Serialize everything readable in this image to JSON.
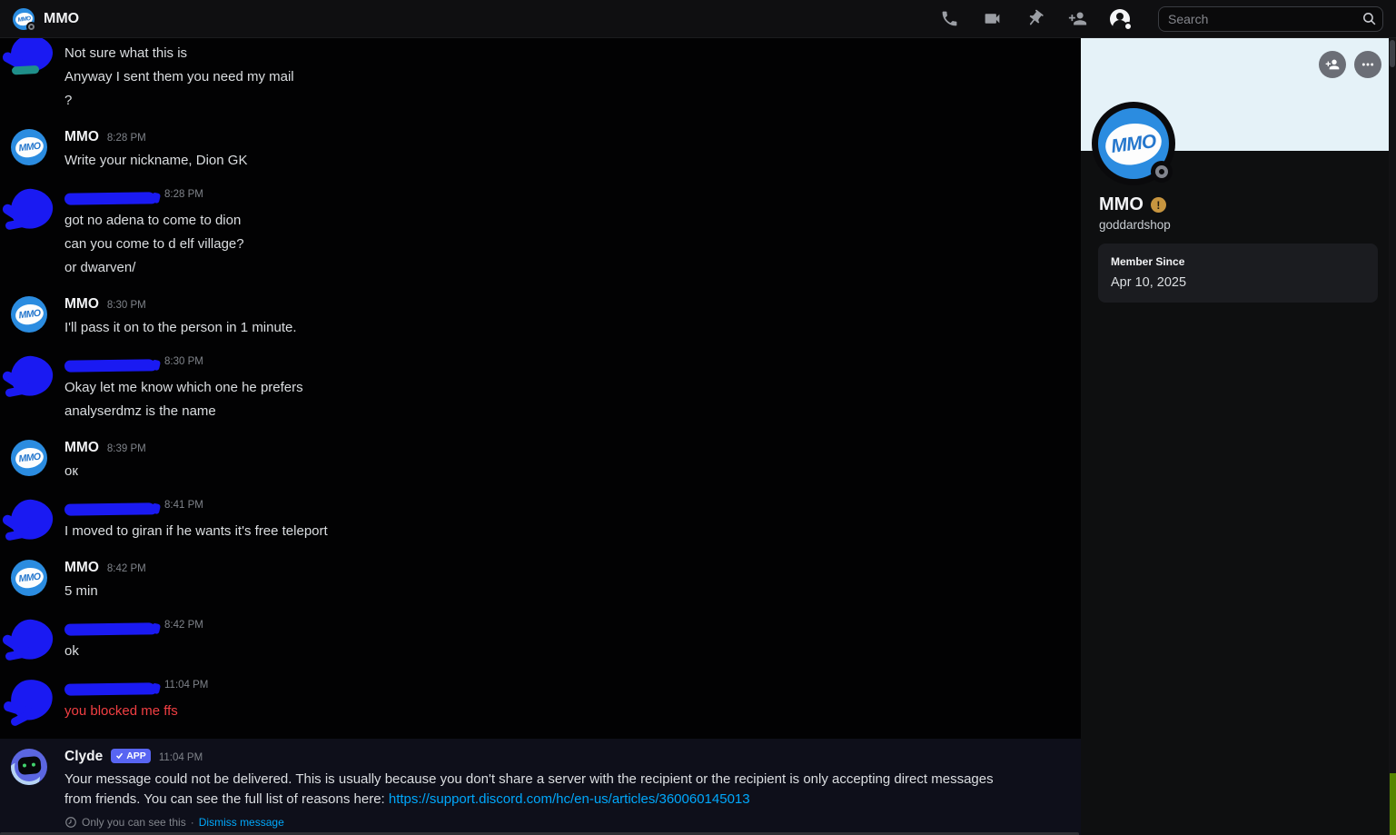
{
  "topbar": {
    "title": "MMO",
    "search_placeholder": "Search",
    "icons": [
      {
        "name": "start-voice-call-icon"
      },
      {
        "name": "start-video-call-icon"
      },
      {
        "name": "pinned-messages-icon"
      },
      {
        "name": "add-friends-to-dm-icon"
      },
      {
        "name": "user-profile-icon"
      },
      {
        "name": "search-icon"
      }
    ]
  },
  "chat": {
    "groups": [
      {
        "kind": "user",
        "header": false,
        "partial": true,
        "time": "",
        "lines": [
          {
            "t": "Not sure what this is"
          },
          {
            "t": "Anyway I sent them you need my mail"
          },
          {
            "t": "?"
          }
        ]
      },
      {
        "kind": "mmo",
        "header": true,
        "name": "MMO",
        "time": "8:28 PM",
        "lines": [
          {
            "t": "Write your nickname, Dion GK"
          }
        ]
      },
      {
        "kind": "user",
        "header": true,
        "time": "8:28 PM",
        "lines": [
          {
            "t": "got no adena to come to dion"
          },
          {
            "t": "can you come to d elf village?"
          },
          {
            "t": "or dwarven/"
          }
        ]
      },
      {
        "kind": "mmo",
        "header": true,
        "name": "MMO",
        "time": "8:30 PM",
        "lines": [
          {
            "t": "I'll pass it on to the person in 1 minute."
          }
        ]
      },
      {
        "kind": "user",
        "header": true,
        "time": "8:30 PM",
        "lines": [
          {
            "t": "Okay let me know which one he prefers"
          },
          {
            "t": "analyserdmz is the name"
          }
        ]
      },
      {
        "kind": "mmo",
        "header": true,
        "name": "MMO",
        "time": "8:39 PM",
        "lines": [
          {
            "t": "ок"
          }
        ]
      },
      {
        "kind": "user",
        "header": true,
        "time": "8:41 PM",
        "lines": [
          {
            "t": "I moved to giran if he wants it's free teleport"
          }
        ]
      },
      {
        "kind": "mmo",
        "header": true,
        "name": "MMO",
        "time": "8:42 PM",
        "lines": [
          {
            "t": "5 min"
          }
        ]
      },
      {
        "kind": "user",
        "header": true,
        "time": "8:42 PM",
        "lines": [
          {
            "t": "ok"
          }
        ]
      },
      {
        "kind": "user",
        "header": true,
        "time": "11:04 PM",
        "lines": [
          {
            "t": "you blocked me ffs",
            "error": true
          }
        ]
      }
    ],
    "clyde": {
      "name": "Clyde",
      "badge": "APP",
      "time": "11:04 PM",
      "body": "Your message could not be delivered. This is usually because you don't share a server with the recipient or the recipient is only accepting direct messages from friends. You can see the full list of reasons here: ",
      "link": "https://support.discord.com/hc/en-us/articles/360060145013",
      "footer_note": "Only you can see this",
      "footer_sep": "·",
      "footer_action": "Dismiss message"
    }
  },
  "profile": {
    "name": "MMO",
    "username": "goddardshop",
    "avatar_text": "MMO",
    "warning_glyph": "!",
    "member_since_label": "Member Since",
    "member_since_value": "Apr 10, 2025"
  },
  "colors": {
    "chat_bg": "#020203",
    "topbar_bg": "#0f0f11",
    "sidebar_bg": "#0e0f10",
    "banner": "#e5f2f8",
    "redaction_blue": "#1a1af2",
    "mmo_avatar_blue": "#2b8ce0",
    "error_red": "#f23f43",
    "link_blue": "#00a8fc",
    "app_badge": "#5865f2",
    "warning_badge": "#c7953f",
    "ephemeral_bg": "#0e0f1a",
    "green_bar": "#578600"
  }
}
